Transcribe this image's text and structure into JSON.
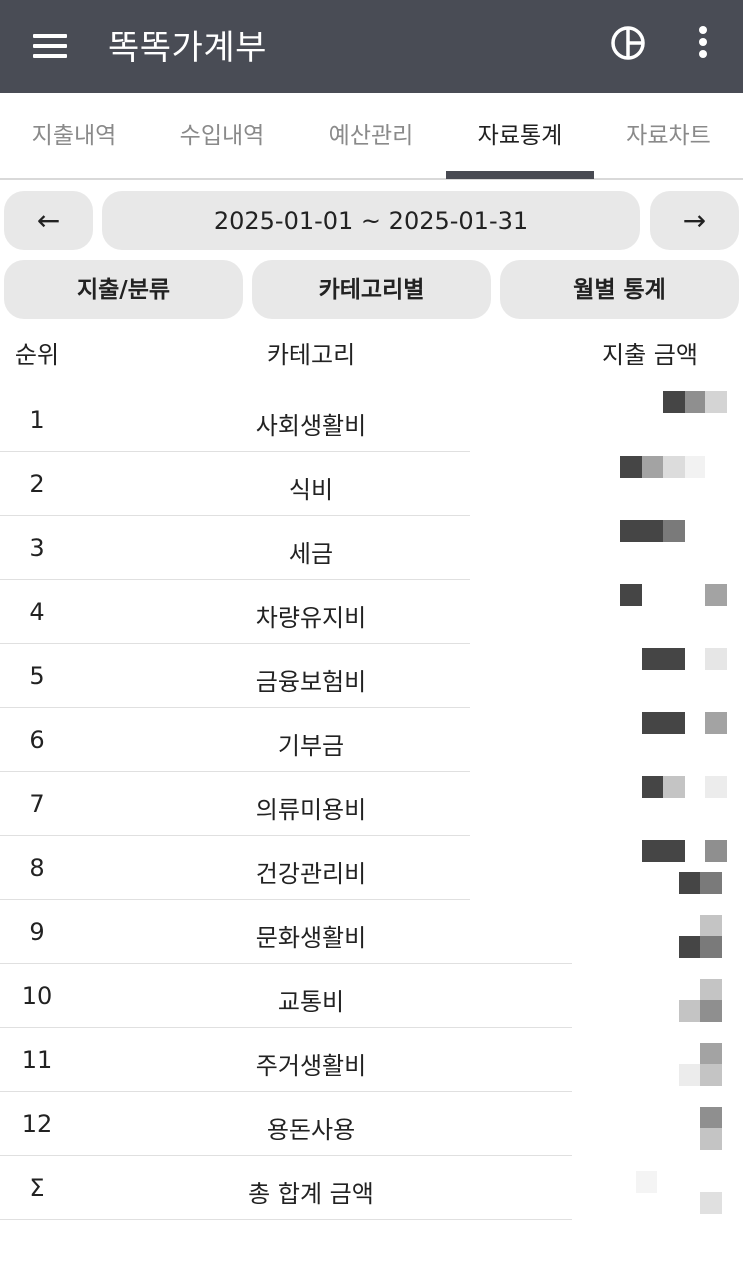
{
  "app": {
    "title": "똑똑가계부"
  },
  "icons": {
    "menu": "hamburger-menu-icon",
    "chart": "pie-chart-icon",
    "more": "more-vertical-icon"
  },
  "tabs": [
    {
      "label": "지출내역"
    },
    {
      "label": "수입내역"
    },
    {
      "label": "예산관리"
    },
    {
      "label": "자료통계",
      "active": true
    },
    {
      "label": "자료차트"
    }
  ],
  "date_nav": {
    "prev": "←",
    "range": "2025-01-01 ~ 2025-01-31",
    "next": "→"
  },
  "view_buttons": [
    {
      "label": "지출/분류"
    },
    {
      "label": "카테고리별"
    },
    {
      "label": "월별 통계"
    }
  ],
  "table": {
    "headers": {
      "rank": "순위",
      "category": "카테고리",
      "amount": "지출 금액"
    },
    "rows": [
      {
        "rank": "1",
        "category": "사회생활비"
      },
      {
        "rank": "2",
        "category": "식비"
      },
      {
        "rank": "3",
        "category": "세금"
      },
      {
        "rank": "4",
        "category": "차량유지비"
      },
      {
        "rank": "5",
        "category": "금융보험비"
      },
      {
        "rank": "6",
        "category": "기부금"
      },
      {
        "rank": "7",
        "category": "의류미용비"
      },
      {
        "rank": "8",
        "category": "건강관리비"
      },
      {
        "rank": "9",
        "category": "문화생활비"
      },
      {
        "rank": "10",
        "category": "교통비"
      },
      {
        "rank": "11",
        "category": "주거생활비"
      },
      {
        "rank": "12",
        "category": "용돈사용"
      },
      {
        "rank": "Σ",
        "category": "총 합계 금액"
      }
    ]
  },
  "colors": {
    "appbar": "#494c55",
    "pill": "#e8e8e8",
    "active_tab": "#484a52",
    "pixelation": "#454545"
  }
}
